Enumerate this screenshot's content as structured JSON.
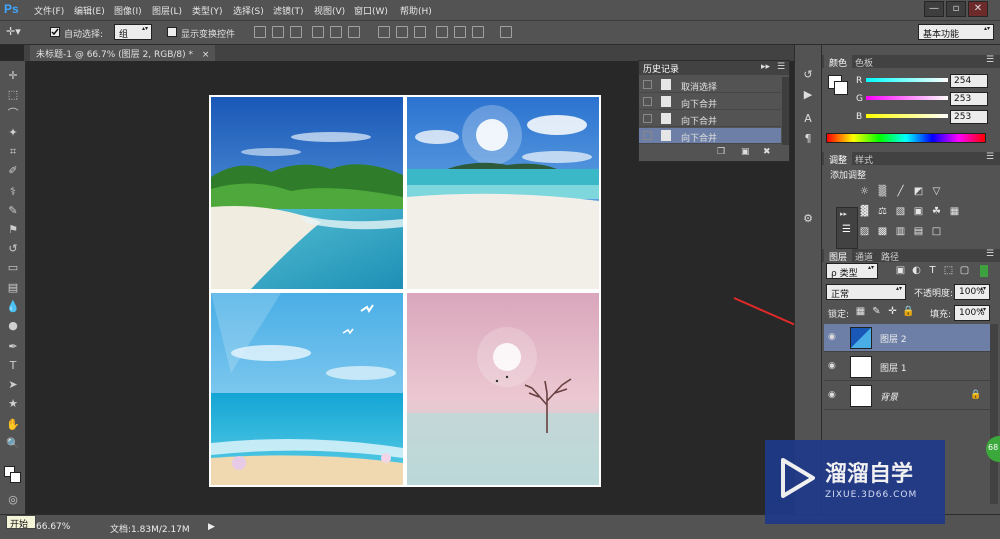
{
  "app": {
    "logo": "Ps",
    "menus": [
      "文件(F)",
      "编辑(E)",
      "图像(I)",
      "图层(L)",
      "类型(Y)",
      "选择(S)",
      "滤镜(T)",
      "视图(V)",
      "窗口(W)",
      "帮助(H)"
    ],
    "window_controls": [
      "—",
      "▫",
      "✕"
    ]
  },
  "options_bar": {
    "auto_select_label": "自动选择:",
    "auto_select_value": "组",
    "show_transform_label": "显示变换控件",
    "workspace": "基本功能"
  },
  "document_tab": {
    "title": "未标题-1 @ 66.7% (图层 2, RGB/8) *",
    "close": "×"
  },
  "history_panel": {
    "title": "历史记录",
    "items": [
      "取消选择",
      "向下合并",
      "向下合并",
      "向下合并"
    ],
    "selected_index": 3
  },
  "color_panel": {
    "tabs": [
      "颜色",
      "色板"
    ],
    "r_label": "R",
    "r_value": "254",
    "g_label": "G",
    "g_value": "253",
    "b_label": "B",
    "b_value": "253"
  },
  "adjust_panel": {
    "tabs": [
      "调整",
      "样式"
    ],
    "heading": "添加调整"
  },
  "layers_panel": {
    "tabs": [
      "图层",
      "通道",
      "路径"
    ],
    "filter_kind": "ρ 类型",
    "blend_mode": "正常",
    "opacity_label": "不透明度:",
    "opacity_value": "100%",
    "lock_label": "锁定:",
    "fill_label": "填充:",
    "fill_value": "100%",
    "layers": [
      {
        "name": "图层 2",
        "selected": true
      },
      {
        "name": "图层 1",
        "selected": false
      },
      {
        "name": "背景",
        "selected": false
      }
    ]
  },
  "status_bar": {
    "zoom": "66.67%",
    "doc_info": "文档:1.83M/2.17M",
    "start_tooltip": "开始"
  },
  "watermark": {
    "title": "溜溜自学",
    "url": "ZIXUE.3D66.COM",
    "side_badge": "68"
  },
  "colors": {
    "accent_blue": "#6d7fa6",
    "panel_gray": "#535353",
    "canvas_bg": "#282828"
  }
}
